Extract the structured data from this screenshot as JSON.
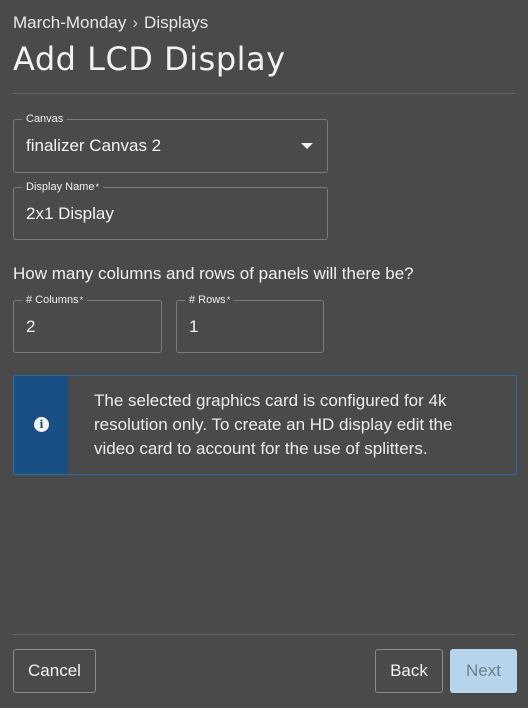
{
  "breadcrumb": {
    "parent": "March-Monday",
    "separator": "›",
    "current": "Displays"
  },
  "page_title": "Add LCD Display",
  "canvas_field": {
    "label": "Canvas",
    "value": "finalizer Canvas 2",
    "icon": "caret-down-icon"
  },
  "display_name_field": {
    "label": "Display Name",
    "required_mark": "*",
    "value": "2x1 Display"
  },
  "question": "How many columns and rows of panels will there be?",
  "columns_field": {
    "label": "# Columns",
    "required_mark": "*",
    "value": "2"
  },
  "rows_field": {
    "label": "# Rows",
    "required_mark": "*",
    "value": "1"
  },
  "info": {
    "icon": "info-icon",
    "text": "The selected graphics card is configured for 4k resolution only. To create an HD display edit the video card to account for the use of splitters.",
    "accent_color": "#1a4f85"
  },
  "footer": {
    "cancel_label": "Cancel",
    "back_label": "Back",
    "next_label": "Next"
  }
}
